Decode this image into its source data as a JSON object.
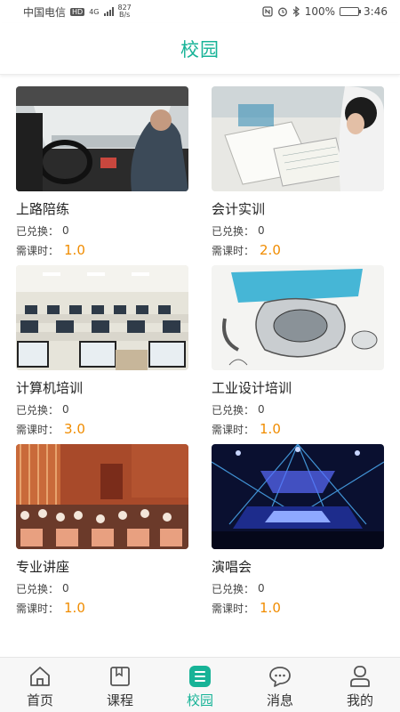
{
  "status_bar": {
    "carrier": "中国电信",
    "hd_badge": "HD",
    "network": "4G",
    "speed_value": "827",
    "speed_unit": "B/s",
    "nfc_icon": "nfc-icon",
    "alarm_icon": "alarm-icon",
    "bluetooth_icon": "bluetooth-icon",
    "battery": "100%",
    "battery_level": 1.0,
    "time": "3:46"
  },
  "header": {
    "title": "校园"
  },
  "labels": {
    "redeemed": "已兑换：",
    "hours": "需课时："
  },
  "courses": [
    {
      "title": "上路陪练",
      "redeemed": "0",
      "hours": "1.0",
      "image": "driving-car-photo"
    },
    {
      "title": "会计实训",
      "redeemed": "0",
      "hours": "2.0",
      "image": "accounting-paperwork-photo"
    },
    {
      "title": "计算机培训",
      "redeemed": "0",
      "hours": "3.0",
      "image": "computer-lab-photo"
    },
    {
      "title": "工业设计培训",
      "redeemed": "0",
      "hours": "1.0",
      "image": "vacuum-sketch-photo"
    },
    {
      "title": "专业讲座",
      "redeemed": "0",
      "hours": "1.0",
      "image": "lecture-hall-photo"
    },
    {
      "title": "演唱会",
      "redeemed": "0",
      "hours": "1.0",
      "image": "concert-stage-photo"
    }
  ],
  "tabs": [
    {
      "label": "首页",
      "icon": "home-icon"
    },
    {
      "label": "课程",
      "icon": "book-icon"
    },
    {
      "label": "校园",
      "icon": "campus-icon"
    },
    {
      "label": "消息",
      "icon": "message-icon"
    },
    {
      "label": "我的",
      "icon": "profile-icon"
    }
  ],
  "colors": {
    "accent": "#17b397",
    "hours": "#f08c00",
    "text": "#222222"
  }
}
